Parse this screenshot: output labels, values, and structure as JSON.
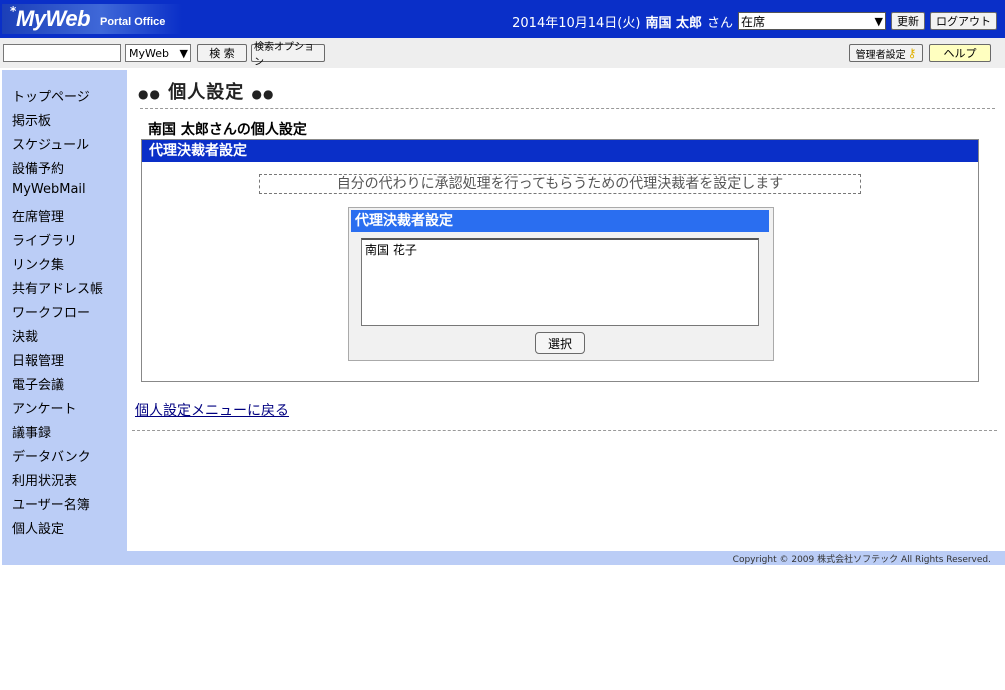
{
  "header": {
    "logo_star": "*",
    "logo_main": "MyWeb",
    "logo_sub": "Portal Office",
    "date": "2014年10月14日(火)",
    "user_name": "南国 太郎",
    "user_suffix": "さん",
    "status_value": "在席",
    "refresh_label": "更新",
    "logout_label": "ログアウト"
  },
  "searchbar": {
    "input_value": "",
    "scope_value": "MyWeb",
    "search_label": "検 索",
    "search_options_label": "検索オプション",
    "admin_settings_label": "管理者設定",
    "help_label": "ヘルプ"
  },
  "sidebar": {
    "items": [
      {
        "label": "トップページ"
      },
      {
        "label": "掲示板"
      },
      {
        "label": "スケジュール"
      },
      {
        "label": "設備予約"
      },
      {
        "label": "MyWebMail"
      },
      {
        "label": "在席管理"
      },
      {
        "label": "ライブラリ"
      },
      {
        "label": "リンク集"
      },
      {
        "label": "共有アドレス帳"
      },
      {
        "label": "ワークフロー"
      },
      {
        "label": "決裁"
      },
      {
        "label": "日報管理"
      },
      {
        "label": "電子会議"
      },
      {
        "label": "アンケート"
      },
      {
        "label": "議事録"
      },
      {
        "label": "データバンク"
      },
      {
        "label": "利用状況表"
      },
      {
        "label": "ユーザー名簿"
      },
      {
        "label": "個人設定"
      }
    ]
  },
  "main": {
    "title_dots_left": "●●",
    "title": "個人設定",
    "title_dots_right": "●●",
    "subtitle": "南国 太郎さんの個人設定",
    "panel_title": "代理決裁者設定",
    "description": "自分の代わりに承認処理を行ってもらうための代理決裁者を設定します",
    "inner_title": "代理決裁者設定",
    "delegates": [
      "南国 花子"
    ],
    "select_label": "選択",
    "back_link": "個人設定メニューに戻る"
  },
  "footer": {
    "copyright": "Copyright © 2009 株式会社ソフテック All Rights Reserved."
  }
}
